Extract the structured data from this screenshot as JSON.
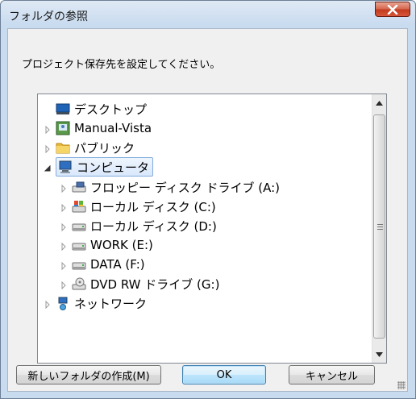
{
  "window": {
    "title": "フォルダの参照"
  },
  "dialog": {
    "instruction": "プロジェクト保存先を設定してください。"
  },
  "tree": {
    "items": [
      {
        "label": "デスクトップ",
        "icon": "desktop-icon",
        "expander": "none"
      },
      {
        "label": "Manual-Vista",
        "icon": "user-folder-icon",
        "expander": "collapsed"
      },
      {
        "label": "パブリック",
        "icon": "folder-icon",
        "expander": "collapsed"
      },
      {
        "label": "コンピュータ",
        "icon": "computer-icon",
        "expander": "expanded",
        "selected": true
      },
      {
        "label": "フロッピー ディスク ドライブ (A:)",
        "icon": "floppy-drive-icon",
        "expander": "collapsed"
      },
      {
        "label": "ローカル ディスク (C:)",
        "icon": "system-drive-icon",
        "expander": "collapsed"
      },
      {
        "label": "ローカル ディスク (D:)",
        "icon": "hard-drive-icon",
        "expander": "collapsed"
      },
      {
        "label": "WORK (E:)",
        "icon": "hard-drive-icon",
        "expander": "collapsed"
      },
      {
        "label": "DATA (F:)",
        "icon": "hard-drive-icon",
        "expander": "collapsed"
      },
      {
        "label": "DVD RW ドライブ (G:)",
        "icon": "dvd-drive-icon",
        "expander": "collapsed"
      },
      {
        "label": "ネットワーク",
        "icon": "network-icon",
        "expander": "collapsed"
      }
    ]
  },
  "buttons": {
    "new_folder": "新しいフォルダの作成(M)",
    "ok": "OK",
    "cancel": "キャンセル"
  },
  "colors": {
    "selection_border": "#84acdd",
    "close_button": "#c23b1c",
    "frame": "#c9dbef"
  }
}
